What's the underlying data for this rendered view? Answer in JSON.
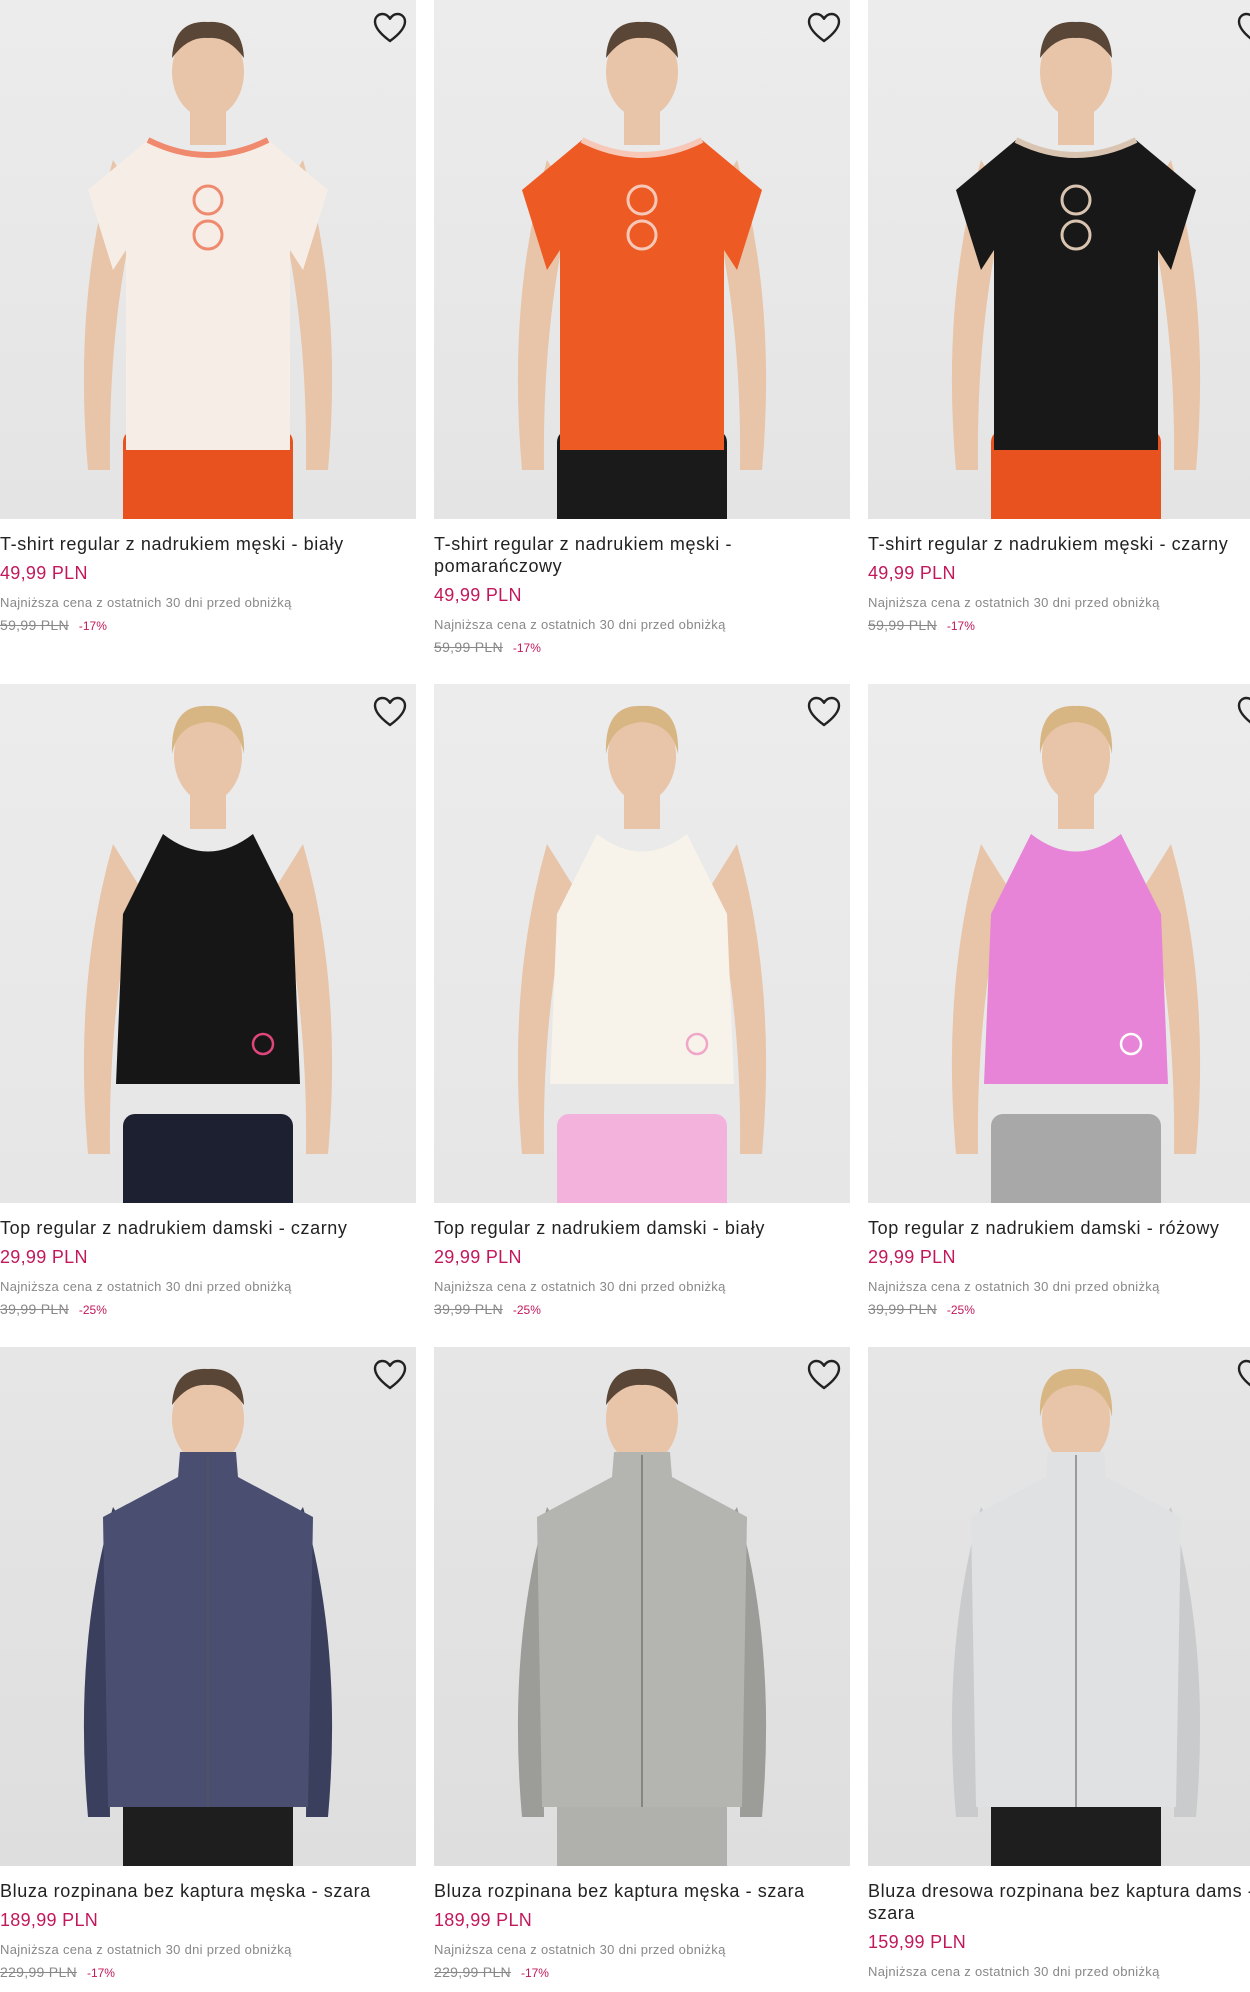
{
  "colors": {
    "price": "#c2185b",
    "muted": "#888888",
    "text": "#222222"
  },
  "wishlist_icon": "heart-outline-icon",
  "products": [
    {
      "title": "T-shirt regular z nadrukiem męski - biały",
      "price": "49,99 PLN",
      "lowest_note": "Najniższa cena z ostatnich 30 dni przed obniżką",
      "old_price": "59,99 PLN",
      "discount": "-17%",
      "garment_color": "#f6eee6",
      "accent": "#f08a6e"
    },
    {
      "title": "T-shirt regular z nadrukiem męski - pomarańczowy",
      "price": "49,99 PLN",
      "lowest_note": "Najniższa cena z ostatnich 30 dni przed obniżką",
      "old_price": "59,99 PLN",
      "discount": "-17%",
      "garment_color": "#ee5a24",
      "accent": "#f7c8b8"
    },
    {
      "title": "T-shirt regular z nadrukiem męski - czarny",
      "price": "49,99 PLN",
      "lowest_note": "Najniższa cena z ostatnich 30 dni przed obniżką",
      "old_price": "59,99 PLN",
      "discount": "-17%",
      "garment_color": "#181818",
      "accent": "#d8c4b0"
    },
    {
      "title": "Top regular z nadrukiem damski - czarny",
      "price": "29,99 PLN",
      "lowest_note": "Najniższa cena z ostatnich 30 dni przed obniżką",
      "old_price": "39,99 PLN",
      "discount": "-25%",
      "garment_color": "#161616",
      "accent": "#e0457b"
    },
    {
      "title": "Top regular z nadrukiem damski - biały",
      "price": "29,99 PLN",
      "lowest_note": "Najniższa cena z ostatnich 30 dni przed obniżką",
      "old_price": "39,99 PLN",
      "discount": "-25%",
      "garment_color": "#f7f3ea",
      "accent": "#f0a6c8"
    },
    {
      "title": "Top regular z nadrukiem damski - różowy",
      "price": "29,99 PLN",
      "lowest_note": "Najniższa cena z ostatnich 30 dni przed obniżką",
      "old_price": "39,99 PLN",
      "discount": "-25%",
      "garment_color": "#e884d8",
      "accent": "#ffffff"
    },
    {
      "title": "Bluza rozpinana bez kaptura męska - szara",
      "price": "189,99 PLN",
      "lowest_note": "Najniższa cena z ostatnich 30 dni przed obniżką",
      "old_price": "229,99 PLN",
      "discount": "-17%",
      "garment_color": "#4a4f72",
      "accent": "#3a3f5e"
    },
    {
      "title": "Bluza rozpinana bez kaptura męska - szara",
      "price": "189,99 PLN",
      "lowest_note": "Najniższa cena z ostatnich 30 dni przed obniżką",
      "old_price": "229,99 PLN",
      "discount": "-17%",
      "garment_color": "#b4b5b0",
      "accent": "#9c9d98"
    },
    {
      "title": "Bluza dresowa rozpinana bez kaptura dams - szara",
      "price": "159,99 PLN",
      "lowest_note": "Najniższa cena z ostatnich 30 dni przed obniżką",
      "old_price": "",
      "discount": "",
      "garment_color": "#dfe1e3",
      "accent": "#c9cbcd"
    }
  ]
}
